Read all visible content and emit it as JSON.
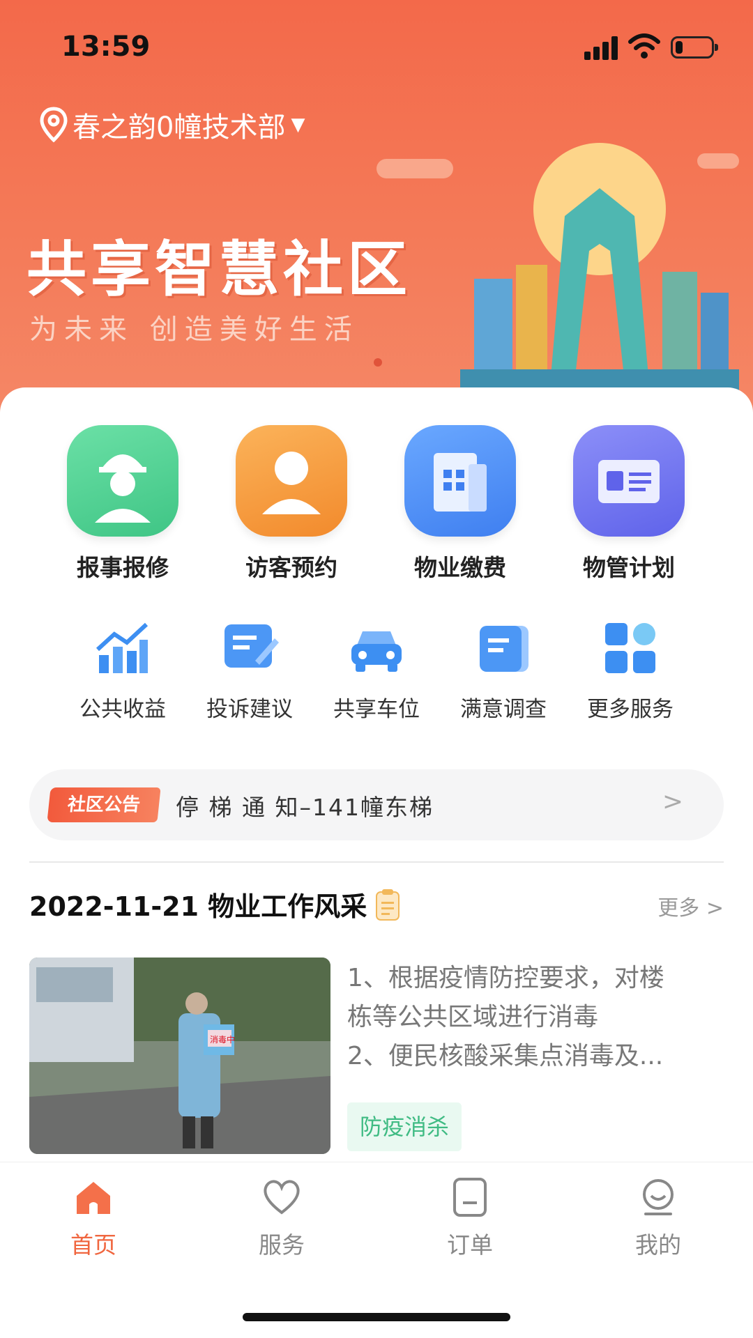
{
  "status": {
    "time": "13:59"
  },
  "location": {
    "name": "春之韵0幢技术部",
    "icon": "map-pin-icon"
  },
  "banner": {
    "title": "共享智慧社区",
    "subtitle": "为未来 创造美好生活"
  },
  "services_main": [
    {
      "label": "报事报修",
      "icon": "worker-icon",
      "color": "#4fcf92"
    },
    {
      "label": "访客预约",
      "icon": "visitor-icon",
      "color": "#f59a3e"
    },
    {
      "label": "物业缴费",
      "icon": "building-icon",
      "color": "#4b8ff5"
    },
    {
      "label": "物管计划",
      "icon": "card-icon",
      "color": "#6b74f0"
    }
  ],
  "services_secondary": [
    {
      "label": "公共收益",
      "icon": "growth-chart-icon"
    },
    {
      "label": "投诉建议",
      "icon": "edit-note-icon"
    },
    {
      "label": "共享车位",
      "icon": "car-icon"
    },
    {
      "label": "满意调查",
      "icon": "survey-icon"
    },
    {
      "label": "更多服务",
      "icon": "grid-icon"
    }
  ],
  "notice": {
    "badge": "社区公告",
    "text": "停 梯 通 知–141幢东梯"
  },
  "news": {
    "title": "2022-11-21 物业工作风采",
    "more": "更多",
    "lines": [
      "1、根据疫情防控要求，对楼",
      "栋等公共区域进行消毒",
      "2、便民核酸采集点消毒及..."
    ],
    "tag": "防疫消杀",
    "image_sign": "消毒中"
  },
  "tabs": [
    {
      "label": "首页",
      "icon": "home-icon",
      "active": true
    },
    {
      "label": "服务",
      "icon": "heart-icon",
      "active": false
    },
    {
      "label": "订单",
      "icon": "order-icon",
      "active": false
    },
    {
      "label": "我的",
      "icon": "profile-icon",
      "active": false
    }
  ],
  "colors": {
    "accent": "#f0663f",
    "hero": "#f47a58",
    "tag_green": "#3fbb83"
  }
}
